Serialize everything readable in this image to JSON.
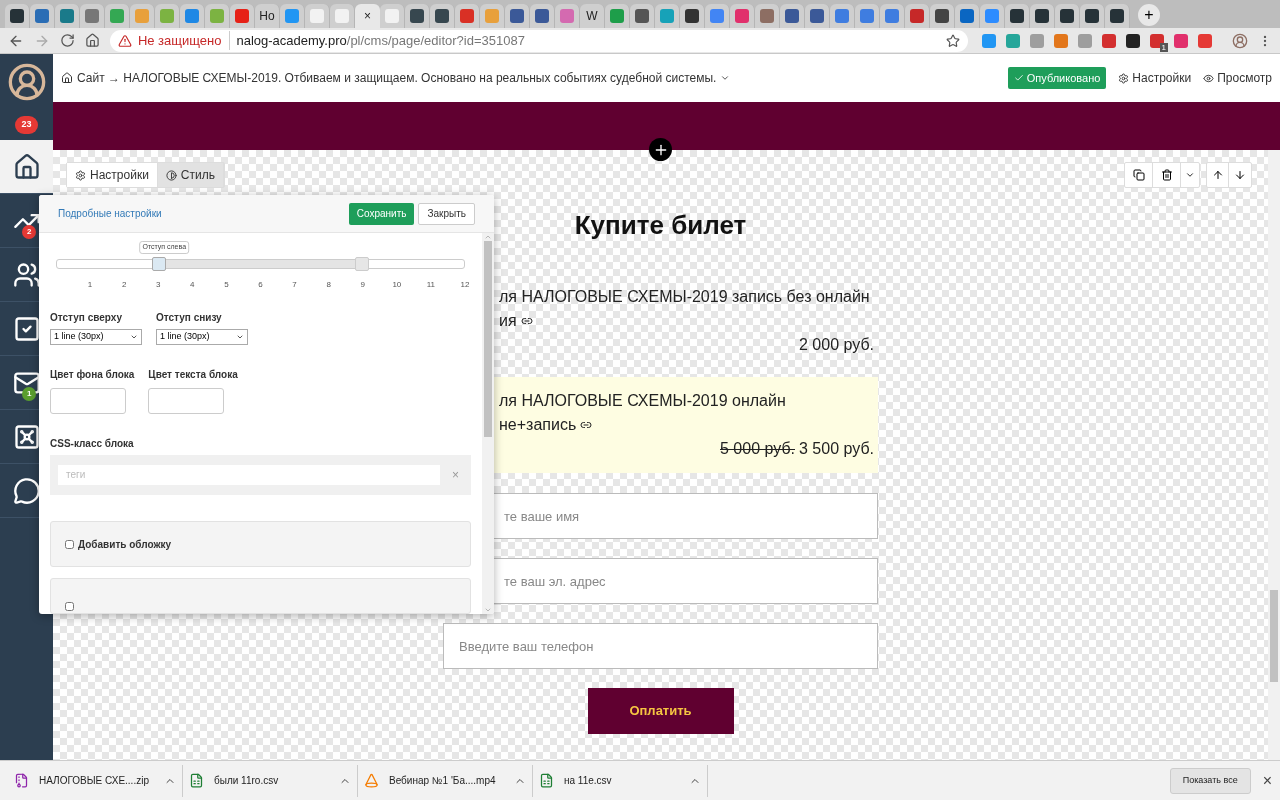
{
  "browser": {
    "tabs": [
      {
        "kind": "icon",
        "color": "#263238",
        "selected": false
      },
      {
        "kind": "icon",
        "color": "#2a6db5",
        "selected": false
      },
      {
        "kind": "icon",
        "color": "#1a7a8a",
        "selected": false
      },
      {
        "kind": "icon",
        "color": "#777777",
        "selected": false
      },
      {
        "kind": "icon",
        "color": "#34a853",
        "selected": false
      },
      {
        "kind": "icon",
        "color": "#e8a03c",
        "selected": false
      },
      {
        "kind": "icon",
        "color": "#7cb342",
        "selected": false
      },
      {
        "kind": "icon",
        "color": "#1e88e5",
        "selected": false
      },
      {
        "kind": "icon",
        "color": "#7cb342",
        "selected": false
      },
      {
        "kind": "icon",
        "color": "#e62117",
        "selected": false
      },
      {
        "kind": "text",
        "label": "Ho",
        "selected": false
      },
      {
        "kind": "icon",
        "color": "#2196f3",
        "selected": false
      },
      {
        "kind": "icon",
        "color": "#f2f2f2",
        "selected": false
      },
      {
        "kind": "icon",
        "color": "#f2f2f2",
        "selected": false
      },
      {
        "kind": "text",
        "label": "×",
        "selected": true
      },
      {
        "kind": "icon",
        "color": "#f2f2f2",
        "selected": false
      },
      {
        "kind": "icon",
        "color": "#37474f",
        "selected": false
      },
      {
        "kind": "icon",
        "color": "#37474f",
        "selected": false
      },
      {
        "kind": "icon",
        "color": "#d93025",
        "selected": false
      },
      {
        "kind": "icon",
        "color": "#e8a03c",
        "selected": false
      },
      {
        "kind": "icon",
        "color": "#3b5998",
        "selected": false
      },
      {
        "kind": "icon",
        "color": "#3b5998",
        "selected": false
      },
      {
        "kind": "icon",
        "color": "#d46ab0",
        "selected": false
      },
      {
        "kind": "text",
        "label": "W",
        "selected": false
      },
      {
        "kind": "icon",
        "color": "#1e9e4a",
        "selected": false
      },
      {
        "kind": "icon",
        "color": "#555555",
        "selected": false
      },
      {
        "kind": "icon",
        "color": "#17a2b8",
        "selected": false
      },
      {
        "kind": "icon",
        "color": "#333333",
        "selected": false
      },
      {
        "kind": "icon",
        "color": "#4285f4",
        "selected": false
      },
      {
        "kind": "icon",
        "color": "#e1306c",
        "selected": false
      },
      {
        "kind": "icon",
        "color": "#8d6e63",
        "selected": false
      },
      {
        "kind": "icon",
        "color": "#3b5998",
        "selected": false
      },
      {
        "kind": "icon",
        "color": "#3b5998",
        "selected": false
      },
      {
        "kind": "icon",
        "color": "#3f7de0",
        "selected": false
      },
      {
        "kind": "icon",
        "color": "#3f7de0",
        "selected": false
      },
      {
        "kind": "icon",
        "color": "#3f7de0",
        "selected": false
      },
      {
        "kind": "icon",
        "color": "#c62828",
        "selected": false
      },
      {
        "kind": "icon",
        "color": "#444444",
        "selected": false
      },
      {
        "kind": "icon",
        "color": "#0a66c2",
        "selected": false
      },
      {
        "kind": "icon",
        "color": "#2d8cff",
        "selected": false
      },
      {
        "kind": "icon",
        "color": "#263238",
        "selected": false
      },
      {
        "kind": "icon",
        "color": "#263238",
        "selected": false
      },
      {
        "kind": "icon",
        "color": "#263238",
        "selected": false
      },
      {
        "kind": "icon",
        "color": "#263238",
        "selected": false
      },
      {
        "kind": "icon",
        "color": "#263238",
        "selected": false
      }
    ],
    "new_tab": "+",
    "address": {
      "security": "Не защищено",
      "host": "nalog-academy.pro",
      "path": "/pl/cms/page/editor?id=351087"
    },
    "extensions": [
      {
        "color": "#2196f3"
      },
      {
        "color": "#26a69a"
      },
      {
        "color": "#9e9e9e"
      },
      {
        "color": "#e2761b"
      },
      {
        "color": "#9e9e9e"
      },
      {
        "color": "#d32f2f"
      },
      {
        "color": "#222222"
      },
      {
        "color": "#d32f2f",
        "badge": "1"
      },
      {
        "color": "#e1306c"
      },
      {
        "color": "#e53935"
      }
    ]
  },
  "sidebar": {
    "badge": "23",
    "items": [
      {
        "kind": "home",
        "selected": true
      },
      {
        "kind": "chart",
        "selected": false,
        "badge": "2",
        "color": "#e53935"
      },
      {
        "kind": "users",
        "selected": false
      },
      {
        "kind": "tasks",
        "selected": false
      },
      {
        "kind": "mail",
        "selected": false,
        "badge": "1",
        "color": "#5a9e2f"
      },
      {
        "kind": "safe",
        "selected": false
      },
      {
        "kind": "chat",
        "selected": false
      }
    ]
  },
  "header": {
    "breadcrumb": "Сайт → НАЛОГОВЫЕ СХЕМЫ-2019. Отбиваем и защищаем. Основано на реальных событиях судебной системы.",
    "published": "Опубликовано",
    "settings": "Настройки",
    "preview": "Просмотр"
  },
  "block_tabs": [
    {
      "kind": "settings",
      "label": "Настройки",
      "selected": false
    },
    {
      "kind": "style",
      "label": "Стиль",
      "selected": true
    }
  ],
  "panel": {
    "link": "Подробные настройки",
    "save": "Сохранить",
    "close": "Закрыть",
    "slider": {
      "tooltip": "Отступ слева",
      "start": {
        "level": 0.25
      },
      "end": {
        "level": 0.75
      },
      "ticks": [
        "1",
        "2",
        "3",
        "4",
        "5",
        "6",
        "7",
        "8",
        "9",
        "10",
        "11",
        "12"
      ]
    },
    "top_label": "Отступ сверху",
    "top_value": "1 line (30px)",
    "bottom_label": "Отступ снизу",
    "bottom_value": "1 line (30px)",
    "bg_label": "Цвет фона блока",
    "text_label": "Цвет текста блока",
    "css_label": "CSS-класс блока",
    "tags_placeholder": "теги",
    "tags_clear": "×",
    "cover": {
      "label": "Добавить обложку",
      "checked": false
    },
    "next_checked": false
  },
  "content": {
    "title": "Купите билет",
    "offers": [
      {
        "highlighted": false,
        "lines": [
          "ля НАЛОГОВЫЕ СХЕМЫ-2019 запись без онлайн",
          "ия"
        ],
        "price": "2 000 руб."
      },
      {
        "highlighted": true,
        "lines": [
          "ля НАЛОГОВЫЕ СХЕМЫ-2019 онлайн",
          "не+запись"
        ],
        "old_price": "5 000 руб.",
        "price": "3 500 руб."
      }
    ],
    "fields": [
      {
        "placeholder": "те ваше имя",
        "covered": true
      },
      {
        "placeholder": "те ваш эл. адрес",
        "covered": true
      },
      {
        "placeholder": "Введите ваш телефон",
        "covered": false
      }
    ],
    "pay": "Оплатить"
  },
  "downloads": {
    "items": [
      {
        "kind": "archive",
        "name": "НАЛОГОВЫЕ СХЕ....zip"
      },
      {
        "kind": "sheet",
        "name": "были 11ro.csv"
      },
      {
        "kind": "video",
        "name": "Вебинар №1 'Ба....mp4"
      },
      {
        "kind": "sheet",
        "name": "на 11e.csv"
      }
    ],
    "show_all": "Показать все",
    "close": "×"
  }
}
